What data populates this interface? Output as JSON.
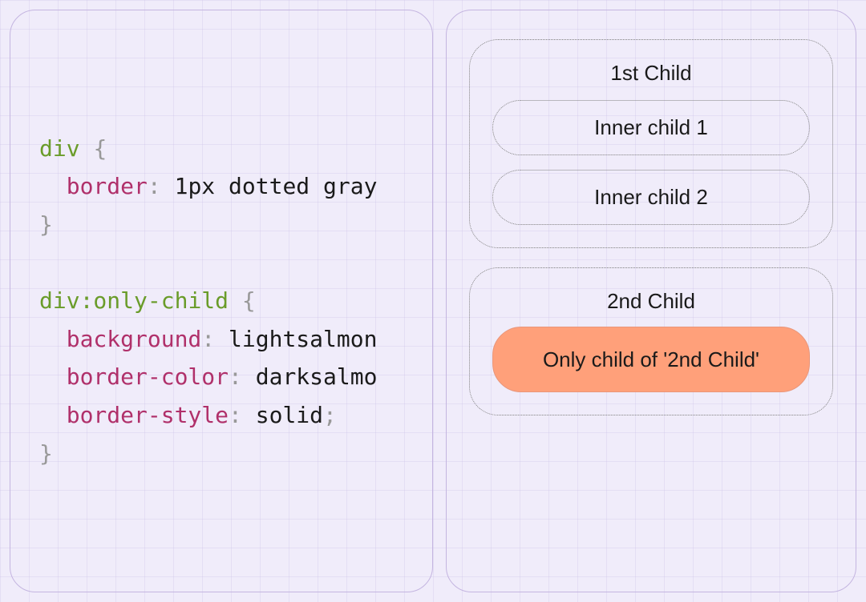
{
  "code": {
    "rule1": {
      "selector": "div",
      "open": "{",
      "prop1": "border",
      "colon": ":",
      "val1": "1px dotted gray",
      "close": "}"
    },
    "rule2": {
      "selector": "div",
      "pseudo": ":only-child",
      "open": "{",
      "prop1": "background",
      "val1": "lightsalmon",
      "prop2": "border-color",
      "val2": "darksalmo",
      "prop3": "border-style",
      "val3": "solid",
      "semi": ";",
      "close": "}",
      "colon": ":"
    }
  },
  "preview": {
    "box1": {
      "title": "1st Child",
      "inner1": "Inner child 1",
      "inner2": "Inner child 2"
    },
    "box2": {
      "title": "2nd Child",
      "only": "Only child of '2nd Child'"
    }
  }
}
